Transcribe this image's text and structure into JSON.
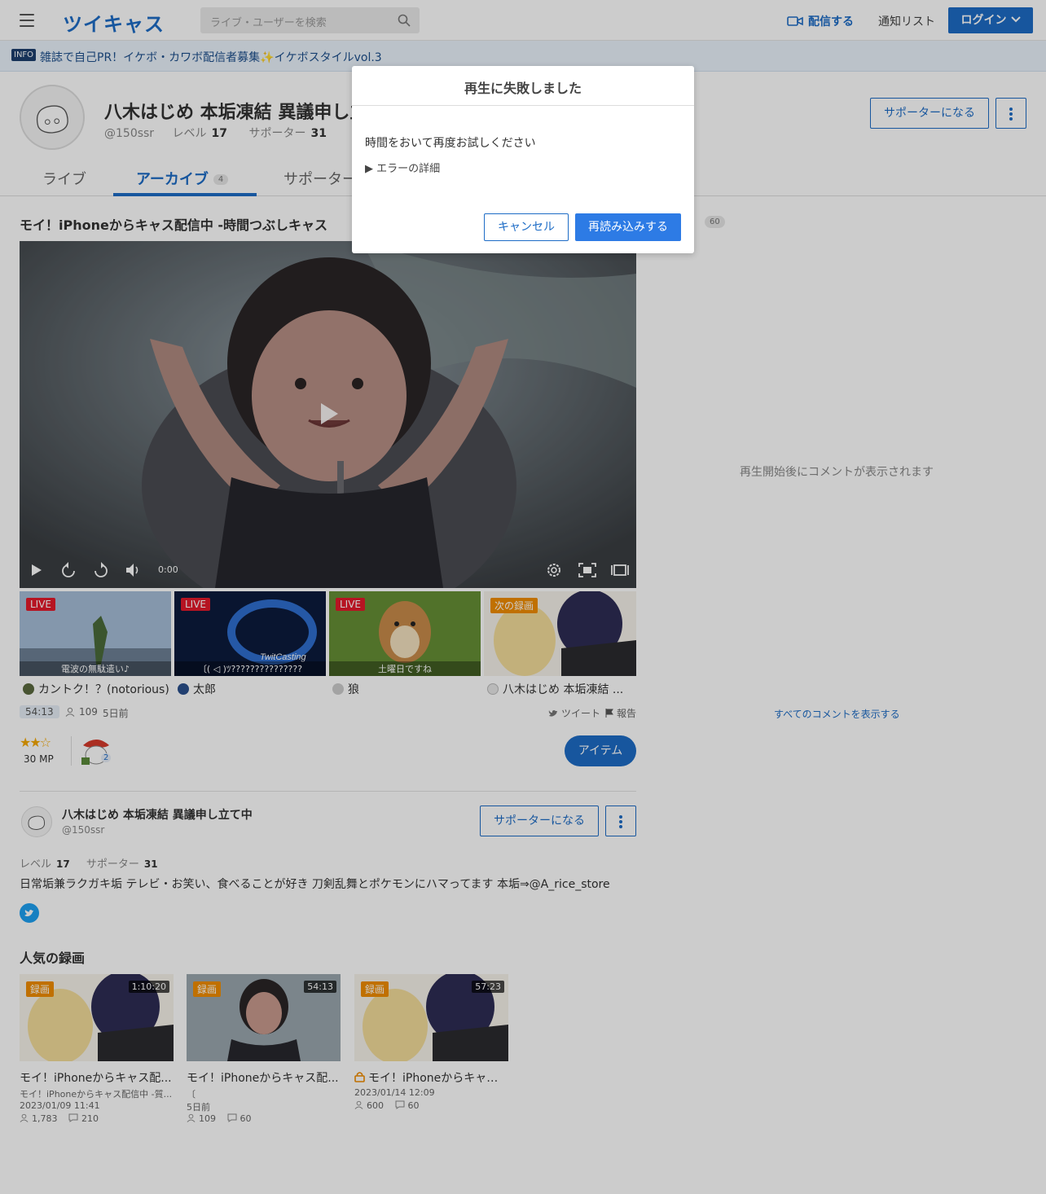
{
  "header": {
    "logo": "ツイキャス",
    "search_placeholder": "ライブ・ユーザーを検索",
    "broadcast": "配信する",
    "notify_list": "通知リスト",
    "login": "ログイン"
  },
  "info": {
    "badge": "INFO",
    "text": "雑誌で自己PR！イケボ・カワボ配信者募集✨イケボスタイルvol.3"
  },
  "profile": {
    "name": "八木はじめ 本垢凍結 異議申し立",
    "handle": "@150ssr",
    "level_label": "レベル",
    "level": "17",
    "supporter_label": "サポーター",
    "supporter": "31",
    "supporter_button": "サポーターになる"
  },
  "tabs": [
    {
      "label": "ライブ",
      "count": ""
    },
    {
      "label": "アーカイブ",
      "count": "4"
    },
    {
      "label": "サポーター",
      "count": ""
    }
  ],
  "video": {
    "title": "モイ！iPhoneからキャス配信中 -時間つぶしキャス",
    "time": "0:00"
  },
  "related": [
    {
      "tag": "LIVE",
      "caption": "電波の無駄遣い♪",
      "name": "カントク！？(notorious)",
      "colors": [
        "#9bb7d8",
        "#6f8aa6"
      ]
    },
    {
      "tag": "LIVE",
      "caption": "〔( ◁ )ﾂ???????????????",
      "name": "太郎",
      "colors": [
        "#0b1a3a",
        "#1b5bb8"
      ]
    },
    {
      "tag": "LIVE",
      "caption": "土曜日ですね",
      "name": "狼",
      "colors": [
        "#5f8a2f",
        "#7ea63d"
      ]
    },
    {
      "tag": "次の録画",
      "caption": "",
      "name": "八木はじめ 本垢凍結 ...",
      "colors": [
        "#f4e6b0",
        "#2b2b3b"
      ]
    }
  ],
  "stats": {
    "duration": "54:13",
    "views": "109",
    "ago": "5日前",
    "tweet": "ツイート",
    "report": "報告",
    "mp": "30 MP",
    "gift_count": "2",
    "item_button": "アイテム"
  },
  "owner": {
    "name": "八木はじめ 本垢凍結 異議申し立て中",
    "handle": "@150ssr",
    "level_label": "レベル",
    "level": "17",
    "supporter_label": "サポーター",
    "supporter": "31",
    "supporter_button": "サポーターになる",
    "bio": "日常垢兼ラクガキ垢 テレビ・お笑い、食べることが好き 刀剣乱舞とポケモンにハマってます 本垢⇒@A_rice_store"
  },
  "popular": {
    "title": "人気の録画",
    "items": [
      {
        "tag": "録画",
        "duration": "1:10:20",
        "title": "モイ！iPhoneからキャス配...",
        "sub": "モイ！iPhoneからキャス配信中 -質...",
        "date": "2023/01/09 11:41",
        "views": "1,783",
        "comments": "210",
        "locked": false
      },
      {
        "tag": "録画",
        "duration": "54:13",
        "title": "モイ！iPhoneからキャス配...",
        "sub": "〔",
        "date": "5日前",
        "views": "109",
        "comments": "60",
        "locked": false
      },
      {
        "tag": "録画",
        "duration": "57:23",
        "title": "モイ！iPhoneからキャス...",
        "sub": "",
        "date": "2023/01/14 12:09",
        "views": "600",
        "comments": "60",
        "locked": true
      }
    ]
  },
  "comments": {
    "count": "60",
    "empty_text": "再生開始後にコメントが表示されます",
    "show_all": "すべてのコメントを表示する"
  },
  "modal": {
    "title": "再生に失敗しました",
    "message": "時間をおいて再度お試しください",
    "details": "▶ エラーの詳細",
    "cancel": "キャンセル",
    "reload": "再読み込みする"
  },
  "colors": {
    "brand": "#1d6cc6",
    "live": "#e4192b",
    "recording": "#f08c00"
  }
}
